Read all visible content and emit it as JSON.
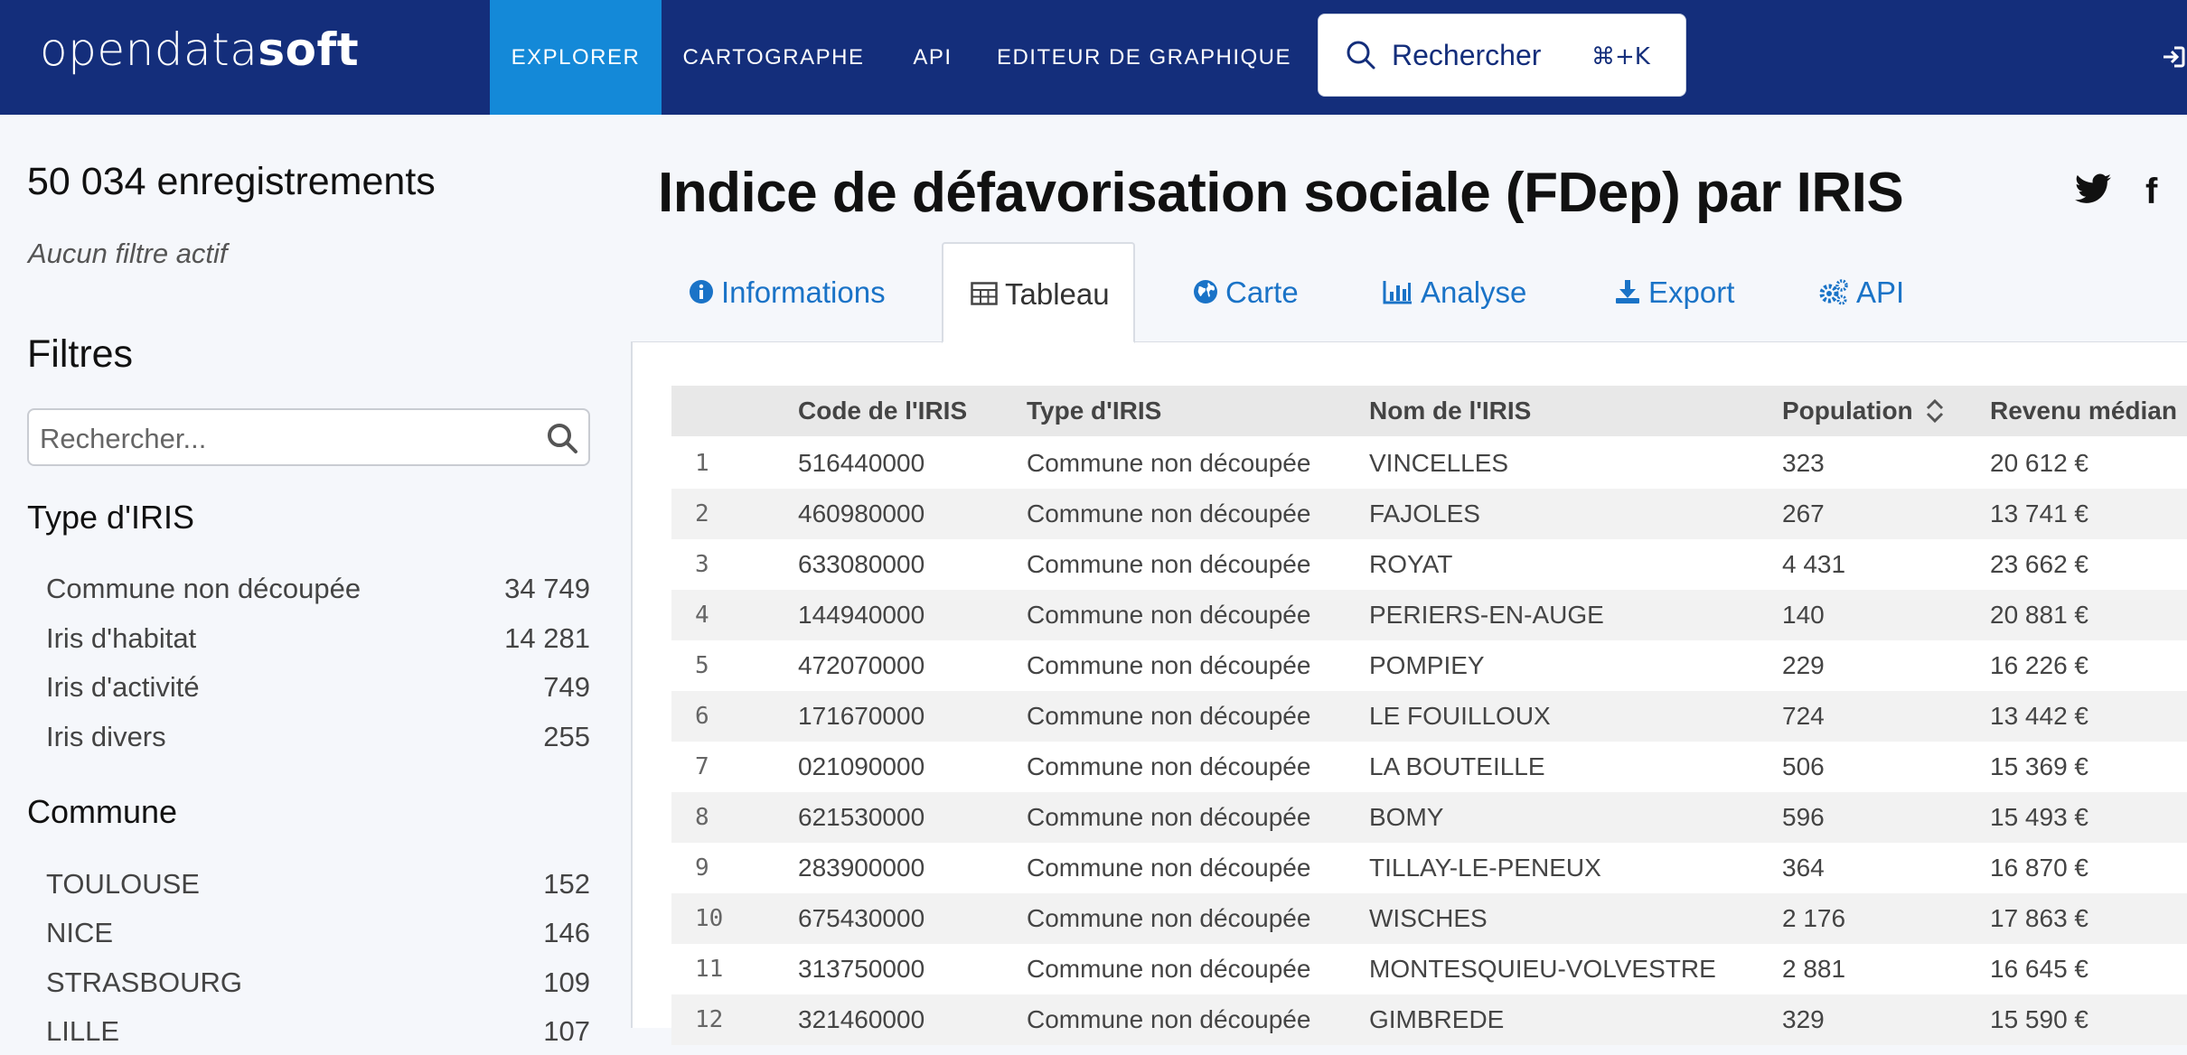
{
  "header": {
    "logo_part1": "opendata",
    "logo_part2": "soft",
    "nav": [
      "EXPLORER",
      "CARTOGRAPHE",
      "API",
      "EDITEUR DE GRAPHIQUE"
    ],
    "search_label": "Rechercher",
    "search_shortcut": "⌘+K",
    "colors": {
      "bar": "#142e7b",
      "active": "#1489d8"
    }
  },
  "sidebar": {
    "record_count": "50 034 enregistrements",
    "no_filter": "Aucun filtre actif",
    "filters_title": "Filtres",
    "search_placeholder": "Rechercher...",
    "facets": [
      {
        "title": "Type d'IRIS",
        "items": [
          {
            "label": "Commune non découpée",
            "count": "34 749"
          },
          {
            "label": "Iris d'habitat",
            "count": "14 281"
          },
          {
            "label": "Iris d'activité",
            "count": "749"
          },
          {
            "label": "Iris divers",
            "count": "255"
          }
        ]
      },
      {
        "title": "Commune",
        "items": [
          {
            "label": "TOULOUSE",
            "count": "152"
          },
          {
            "label": "NICE",
            "count": "146"
          },
          {
            "label": "STRASBOURG",
            "count": "109"
          },
          {
            "label": "LILLE",
            "count": "107"
          }
        ]
      }
    ]
  },
  "main": {
    "title": "Indice de défavorisation sociale (FDep) par IRIS",
    "tabs": [
      {
        "label": "Informations",
        "icon": "info-circle-icon"
      },
      {
        "label": "Tableau",
        "icon": "table-icon",
        "active": true
      },
      {
        "label": "Carte",
        "icon": "globe-icon"
      },
      {
        "label": "Analyse",
        "icon": "bar-chart-icon"
      },
      {
        "label": "Export",
        "icon": "download-icon"
      },
      {
        "label": "API",
        "icon": "cogs-icon"
      }
    ],
    "table": {
      "columns": [
        "",
        "Code de l'IRIS",
        "Type d'IRIS",
        "Nom de l'IRIS",
        "Population",
        "Revenu médian"
      ],
      "rows": [
        [
          "1",
          "516440000",
          "Commune non découpée",
          "VINCELLES",
          "323",
          "20 612 €"
        ],
        [
          "2",
          "460980000",
          "Commune non découpée",
          "FAJOLES",
          "267",
          "13 741 €"
        ],
        [
          "3",
          "633080000",
          "Commune non découpée",
          "ROYAT",
          "4 431",
          "23 662 €"
        ],
        [
          "4",
          "144940000",
          "Commune non découpée",
          "PERIERS-EN-AUGE",
          "140",
          "20 881 €"
        ],
        [
          "5",
          "472070000",
          "Commune non découpée",
          "POMPIEY",
          "229",
          "16 226 €"
        ],
        [
          "6",
          "171670000",
          "Commune non découpée",
          "LE FOUILLOUX",
          "724",
          "13 442 €"
        ],
        [
          "7",
          "021090000",
          "Commune non découpée",
          "LA BOUTEILLE",
          "506",
          "15 369 €"
        ],
        [
          "8",
          "621530000",
          "Commune non découpée",
          "BOMY",
          "596",
          "15 493 €"
        ],
        [
          "9",
          "283900000",
          "Commune non découpée",
          "TILLAY-LE-PENEUX",
          "364",
          "16 870 €"
        ],
        [
          "10",
          "675430000",
          "Commune non découpée",
          "WISCHES",
          "2 176",
          "17 863 €"
        ],
        [
          "11",
          "313750000",
          "Commune non découpée",
          "MONTESQUIEU-VOLVESTRE",
          "2 881",
          "16 645 €"
        ],
        [
          "12",
          "321460000",
          "Commune non découpée",
          "GIMBREDE",
          "329",
          "15 590 €"
        ]
      ]
    }
  }
}
